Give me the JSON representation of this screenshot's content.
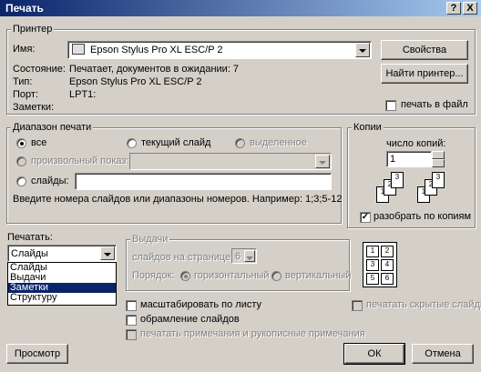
{
  "window": {
    "title": "Печать",
    "help_btn": "?",
    "close_btn": "X"
  },
  "printer": {
    "legend": "Принтер",
    "name_label": "Имя:",
    "name_value": "Epson Stylus Pro XL ESC/P 2",
    "status_label": "Состояние:",
    "status_value": "Печатает, документов в ожидании: 7",
    "type_label": "Тип:",
    "type_value": "Epson Stylus Pro XL ESC/P 2",
    "port_label": "Порт:",
    "port_value": "LPT1:",
    "notes_label": "Заметки:",
    "properties_btn": "Свойства",
    "find_btn": "Найти принтер...",
    "print_to_file": "печать в файл"
  },
  "range": {
    "legend": "Диапазон печати",
    "all": "все",
    "current": "текущий слайд",
    "selection": "выделенное",
    "custom_show": "произвольный показ:",
    "slides": "слайды:",
    "hint": "Введите номера слайдов или диапазоны номеров. Например: 1;3;5-12"
  },
  "copies": {
    "legend": "Копии",
    "count_label": "число копий:",
    "count_value": "1",
    "collate": "разобрать по копиям",
    "stack1": [
      "1",
      "2",
      "3"
    ],
    "stack2": [
      "1",
      "2",
      "3"
    ]
  },
  "print_what": {
    "label": "Печатать:",
    "selected": "Слайды",
    "options": [
      "Слайды",
      "Выдачи",
      "Заметки",
      "Структуру"
    ],
    "highlighted_index": 2
  },
  "handouts": {
    "legend": "Выдачи",
    "per_page_label": "слайдов на странице:",
    "per_page_value": "6",
    "order_label": "Порядок:",
    "horizontal": "горизонтальный",
    "vertical": "вертикальный",
    "preview_cells": [
      "1",
      "2",
      "3",
      "4",
      "5",
      "6"
    ]
  },
  "options": {
    "scale": "масштабировать по листу",
    "frame": "обрамление слайдов",
    "comments": "печатать примечания и рукописные примечания",
    "hidden": "печатать скрытые слайды"
  },
  "footer": {
    "preview_btn": "Просмотр",
    "ok_btn": "ОК",
    "cancel_btn": "Отмена"
  }
}
